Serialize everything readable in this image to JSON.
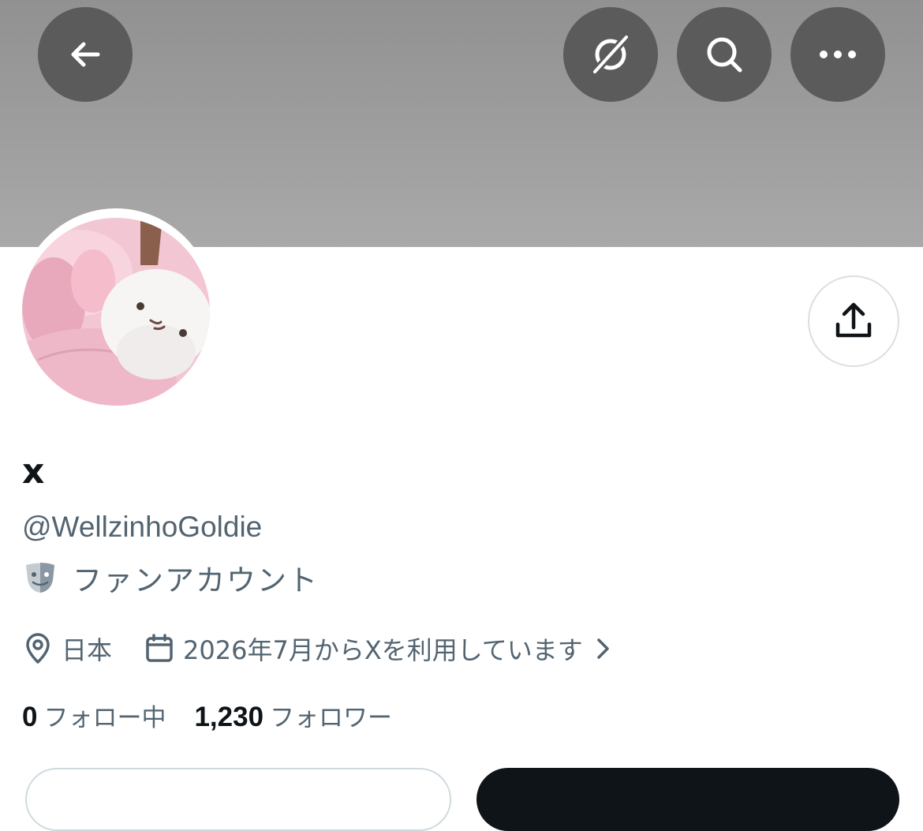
{
  "header": {
    "back_icon": "arrow-left-icon",
    "grok_icon": "grok-slash-circle-icon",
    "search_icon": "search-icon",
    "more_icon": "more-horizontal-icon"
  },
  "profile": {
    "display_name": "x",
    "handle": "@WellzinhoGoldie",
    "category_icon": "theater-masks-icon",
    "category": "ファンアカウント",
    "location": "日本",
    "joined": "2026年7月からXを利用しています",
    "following_count": "0",
    "following_label": "フォロー中",
    "followers_count": "1,230",
    "followers_label": "フォロワー"
  },
  "colors": {
    "banner": "#a0a0a0",
    "overlay_button": "#5b5b5b",
    "secondary_text": "#536471",
    "primary_text": "#0f1419"
  }
}
